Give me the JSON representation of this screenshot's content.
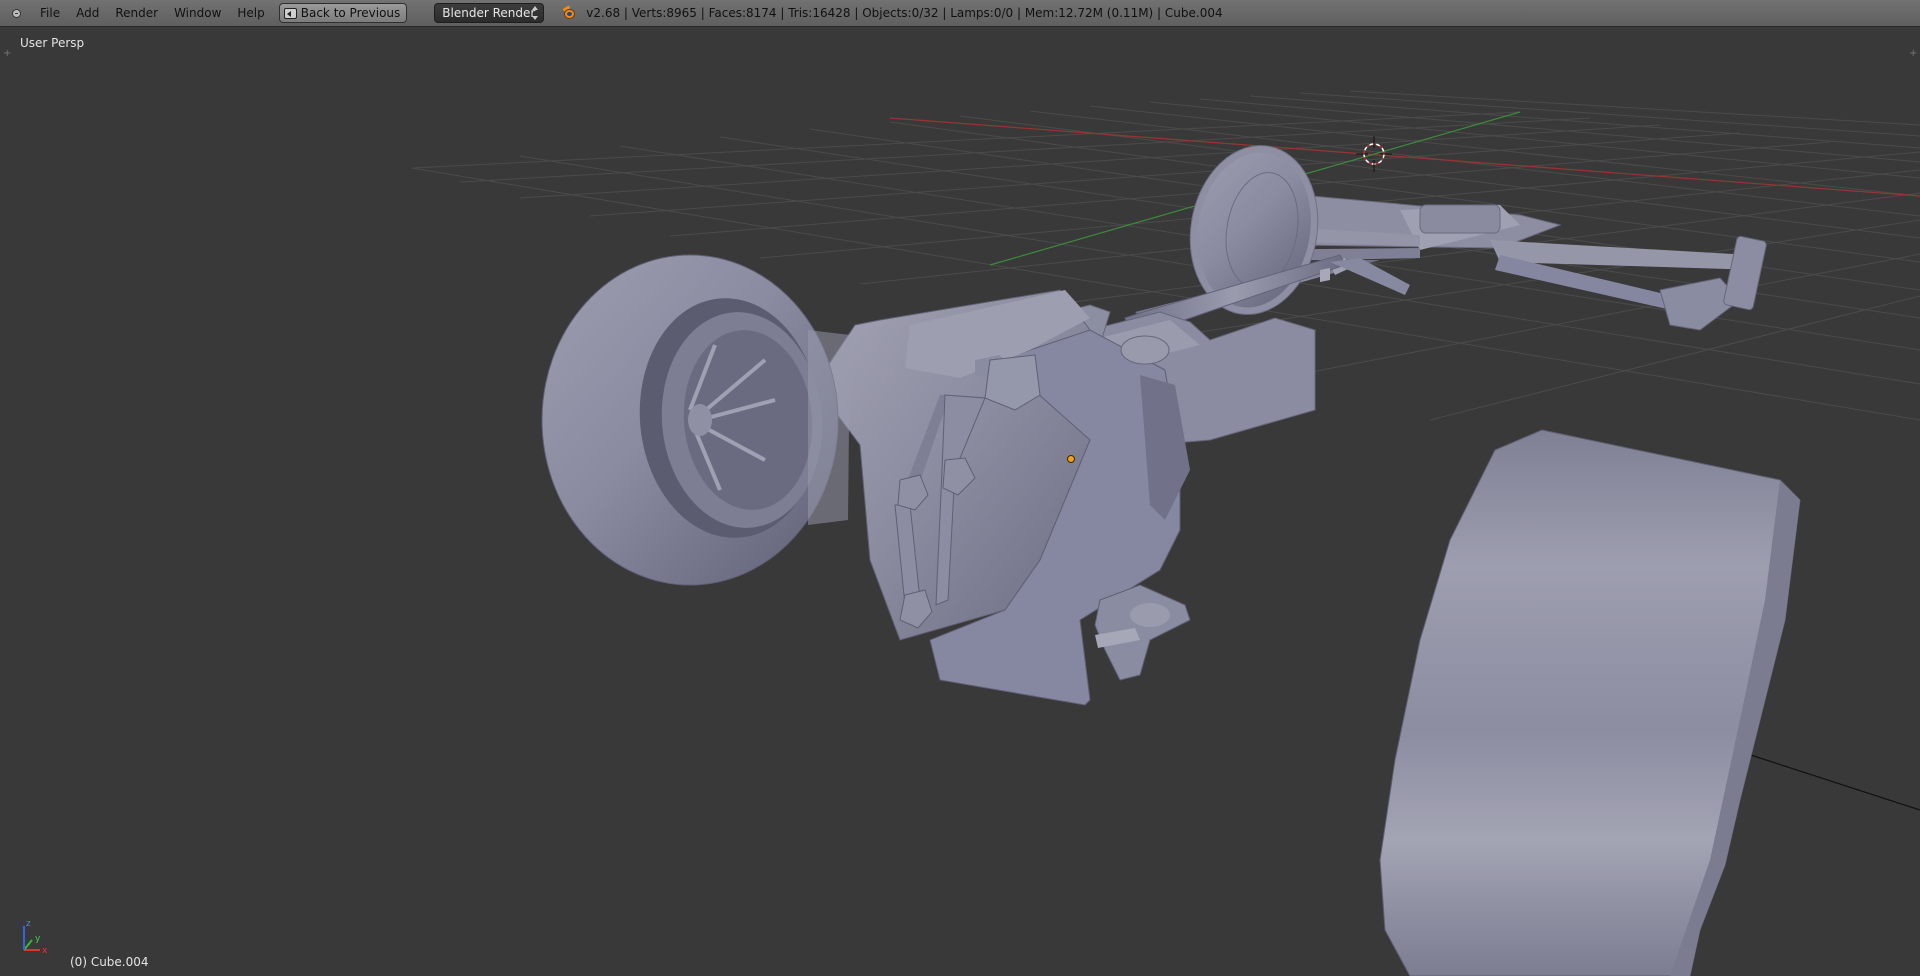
{
  "header": {
    "editor_type_icon": "editor-type-info-icon",
    "menus": [
      "File",
      "Add",
      "Render",
      "Window",
      "Help"
    ],
    "back_button_label": "Back to Previous",
    "render_engine": "Blender Render",
    "blender_icon": "blender-logo-icon",
    "stats": "v2.68 | Verts:8965 | Faces:8174 | Tris:16428 | Objects:0/32 | Lamps:0/0 | Mem:12.72M (0.11M) | Cube.004"
  },
  "viewport": {
    "view_label": "User Persp",
    "object_label": "(0) Cube.004",
    "axis_gizmo": {
      "x": "x",
      "y": "y",
      "z": "z"
    }
  },
  "colors": {
    "viewport_bg": "#393939",
    "header_bg": "#6a6a6a",
    "grid": "#4a4a4a",
    "x_axis": "#9a3434",
    "y_axis": "#3c8a3c",
    "mesh": "#8e8fa4"
  }
}
